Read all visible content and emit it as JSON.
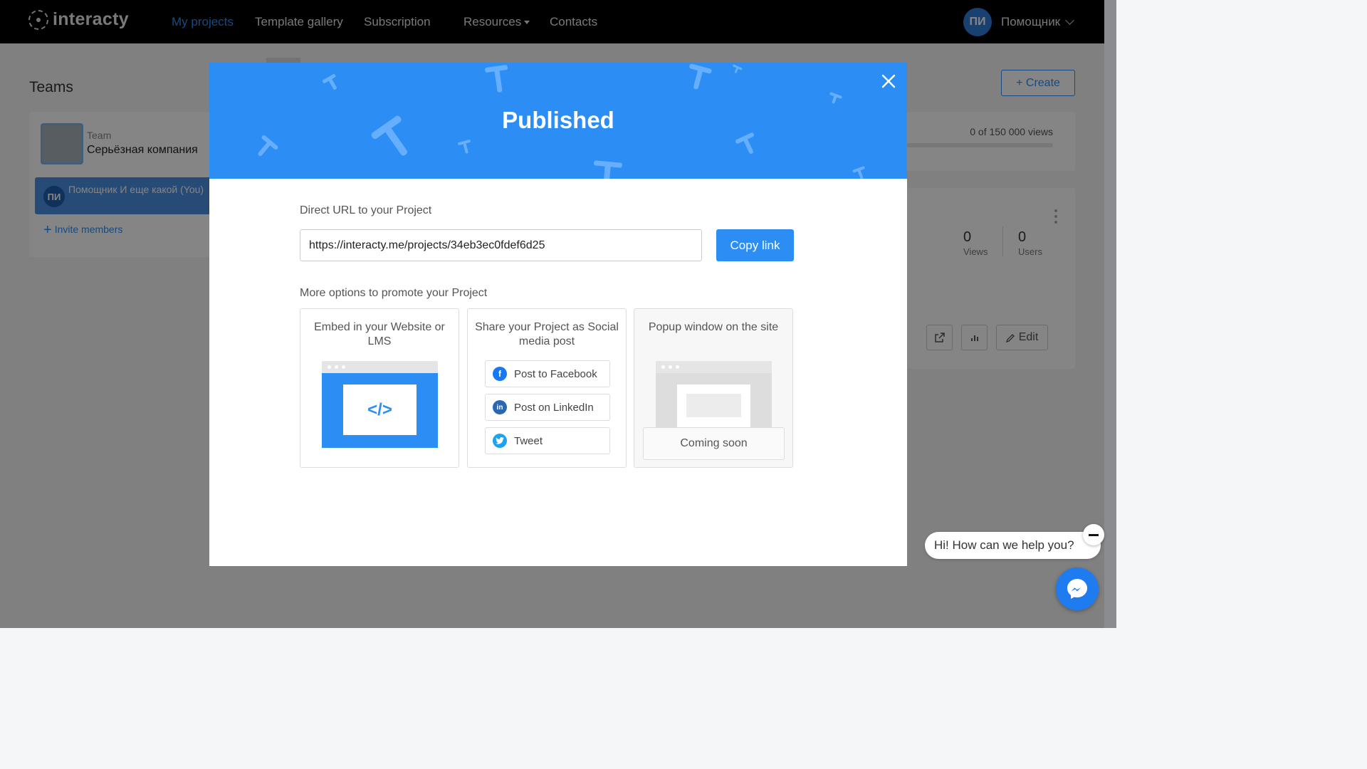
{
  "nav": {
    "logo": "interacty",
    "items": [
      {
        "label": "My projects",
        "active": true
      },
      {
        "label": "Template gallery"
      },
      {
        "label": "Subscription"
      },
      {
        "label": "Resources"
      },
      {
        "label": "Contacts"
      }
    ],
    "user": {
      "initials": "ПИ",
      "name": "Помощник"
    }
  },
  "background": {
    "teams_title": "Teams",
    "team_label": "Team",
    "team_name": "Серьёзная компания",
    "member_initials": "ПИ",
    "member_name": "Помощник И еще какой (You)",
    "invite": "Invite members",
    "create_label": "+ Create",
    "views_usage": "0 of 150 000 views",
    "stats": [
      {
        "value": "0",
        "label": "Views"
      },
      {
        "value": "0",
        "label": "Users"
      }
    ],
    "edit_label": "Edit"
  },
  "modal": {
    "title": "Published",
    "url_label": "Direct URL to your Project",
    "url_value": "https://interacty.me/projects/34eb3ec0fdef6d25",
    "copy_label": "Copy link",
    "more_label": "More options to promote your Project",
    "embed": {
      "title": "Embed in your Website or LMS",
      "code_glyph": "</>"
    },
    "share": {
      "title": "Share your Project as Social media post",
      "buttons": [
        {
          "label": "Post to Facebook",
          "icon": "facebook-icon",
          "color": "#1877f2"
        },
        {
          "label": "Post on LinkedIn",
          "icon": "linkedin-icon",
          "color": "#2867b2"
        },
        {
          "label": "Tweet",
          "icon": "twitter-icon",
          "color": "#1da1f2"
        }
      ]
    },
    "popup": {
      "title": "Popup window on the site",
      "status": "Coming soon"
    }
  },
  "chat": {
    "greeting": "Hi! How can we help you?"
  },
  "colors": {
    "accent": "#2c8ef5",
    "nav_bg": "#000000",
    "header_bg": "#2c8ef5"
  }
}
